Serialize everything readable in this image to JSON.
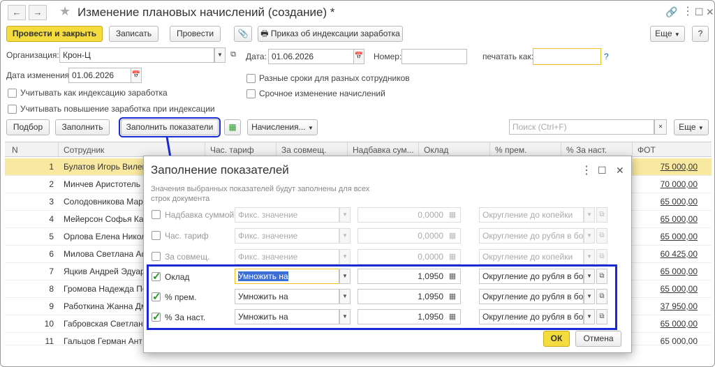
{
  "window": {
    "title": "Изменение плановых начислений (создание) *"
  },
  "toolbar": {
    "post_close": "Провести и закрыть",
    "save": "Записать",
    "post": "Провести",
    "print_order": "Приказ об индексации заработка",
    "more": "Еще",
    "help": "?"
  },
  "form": {
    "org_label": "Организация:",
    "org_value": "Крон-Ц",
    "date_label": "Дата:",
    "date_value": "01.06.2026",
    "number_label": "Номер:",
    "number_value": "",
    "print_as_label": "печатать как:",
    "print_as_value": "",
    "print_as_help": "?",
    "change_date_label": "Дата изменения:",
    "change_date_value": "01.06.2026",
    "cb_indexation": "Учитывать как индексацию заработка",
    "cb_increase": "Учитывать повышение заработка при индексации",
    "cb_diff_terms": "Разные сроки для разных сотрудников",
    "cb_urgent": "Срочное изменение начислений"
  },
  "table_toolbar": {
    "select": "Подбор",
    "fill": "Заполнить",
    "fill_indicators": "Заполнить показатели",
    "accruals": "Начисления...",
    "search_placeholder": "Поиск (Ctrl+F)",
    "more": "Еще"
  },
  "table": {
    "headers": [
      "N",
      "Сотрудник",
      "Час. тариф",
      "За совмещ.",
      "Надбавка сум...",
      "Оклад",
      "% прем.",
      "%  За наст.",
      "ФОТ"
    ],
    "rows": [
      {
        "n": "1",
        "name": "Булатов Игорь Вилен",
        "fot": "75 000,00"
      },
      {
        "n": "2",
        "name": "Минчев Аристотель В",
        "fot": "70 000,00"
      },
      {
        "n": "3",
        "name": "Солодовникова Мари",
        "fot": "65 000,00"
      },
      {
        "n": "4",
        "name": "Мейерсон Софья Кар",
        "fot": "65 000,00"
      },
      {
        "n": "5",
        "name": "Орлова Елена Никола",
        "fot": "65 000,00"
      },
      {
        "n": "6",
        "name": "Милова Светлана Аф",
        "fot": "60 425,00"
      },
      {
        "n": "7",
        "name": "Яцкив Андрей Эдуар",
        "fot": "65 000,00"
      },
      {
        "n": "8",
        "name": "Громова Надежда Пе",
        "fot": "65 000,00"
      },
      {
        "n": "9",
        "name": "Работкина Жанна Дм",
        "fot": "37 950,00"
      },
      {
        "n": "10",
        "name": "Габровская Светлана",
        "fot": "65 000,00"
      },
      {
        "n": "11",
        "name": "Гальцов Герман Ант",
        "fot": "65 000,00"
      }
    ]
  },
  "modal": {
    "title": "Заполнение показателей",
    "description": "Значения выбранных показателей будут заполнены для всех строк документа",
    "rows": [
      {
        "checked": false,
        "enabled": false,
        "label": "Надбавка суммой",
        "mode": "Фикс. значение",
        "value": "0,0000",
        "rounding": "Округление до копейки"
      },
      {
        "checked": false,
        "enabled": false,
        "label": "Час. тариф",
        "mode": "Фикс. значение",
        "value": "0,0000",
        "rounding": "Округление до рубля в бол"
      },
      {
        "checked": false,
        "enabled": false,
        "label": "За совмещ.",
        "mode": "Фикс. значение",
        "value": "0,0000",
        "rounding": "Округление до копейки"
      },
      {
        "checked": true,
        "enabled": true,
        "label": "Оклад",
        "mode": "Умножить на",
        "value": "1,0950",
        "rounding": "Округление до рубля в бол"
      },
      {
        "checked": true,
        "enabled": true,
        "label": "% прем.",
        "mode": "Умножить на",
        "value": "1,0950",
        "rounding": "Округление до рубля в бол"
      },
      {
        "checked": true,
        "enabled": true,
        "label": "%  За наст.",
        "mode": "Умножить на",
        "value": "1,0950",
        "rounding": "Округление до рубля в бол"
      }
    ],
    "ok": "ОК",
    "cancel": "Отмена"
  },
  "colors": {
    "primary_button": "#f5dc3e",
    "selected_row": "#f9e9a0",
    "highlight_frame": "#1a2bd6",
    "check_green": "#2a9a2a"
  }
}
